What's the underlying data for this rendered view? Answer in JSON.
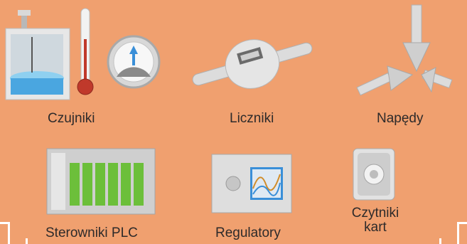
{
  "items": [
    {
      "id": "sensors",
      "label": "Czujniki"
    },
    {
      "id": "meters",
      "label": "Liczniki"
    },
    {
      "id": "drives",
      "label": "Napędy"
    },
    {
      "id": "plc",
      "label": "Sterowniki PLC"
    },
    {
      "id": "regulators",
      "label": "Regulatory"
    },
    {
      "id": "card-readers",
      "label": "Czytniki kart"
    }
  ],
  "colors": {
    "background": "#f0a06f",
    "label": "#2d2a2a",
    "accent_green": "#6cbf3a",
    "accent_blue": "#3a8fd8"
  }
}
